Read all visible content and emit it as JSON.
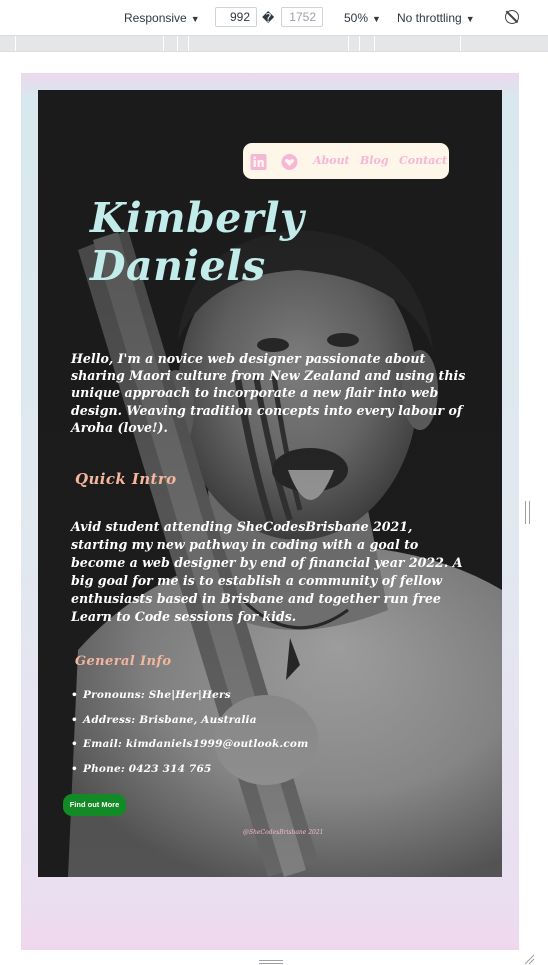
{
  "devtools": {
    "device_mode": "Responsive",
    "width": "992",
    "height_placeholder": "1752",
    "dimension_separator": "�",
    "zoom": "50%",
    "throttling": "No throttling",
    "rotate_icon": "rotate-icon"
  },
  "site": {
    "nav": {
      "linkedin_icon": "linkedin-icon",
      "heart_icon": "heart-icon",
      "links": [
        "About",
        "Blog",
        "Contact"
      ]
    },
    "hero": {
      "name_line1": "Kimberly",
      "name_line2": "Daniels",
      "background": "Black and white photo of a man performing a haka with tongue out, holding a wooden taiaha"
    },
    "bio": "Hello, I'm a novice web designer passionate about sharing Maori culture from New Zealand and using this unique approach to incorporate a new flair into web design. Weaving tradition concepts into every labour of Aroha (love!).",
    "quick_intro": {
      "title": "Quick Intro",
      "text": "Avid student attending SheCodesBrisbane 2021, starting my new pathway in coding with a goal to become a web designer by end of financial year 2022. A big goal for me is to establish a community of fellow enthusiasts based in Brisbane and together run free Learn to Code sessions for kids."
    },
    "general_info": {
      "title": "General Info",
      "items": [
        "Pronouns: She|Her|Hers",
        "Address: Brisbane, Australia",
        "Email: kimdaniels1999@outlook.com",
        "Phone: 0423 314 765"
      ]
    },
    "cta_label": "Find out More",
    "footer": "@SheCodesBrisbane 2021"
  },
  "colors": {
    "name": "#c2ecea",
    "section_title": "#f4b69d",
    "nav_bg": "#fdf6e9",
    "nav_accent": "#f6b7d6",
    "cta": "#128a25",
    "frame_pink": "#ecd8ee",
    "frame_blue": "#d7e9ee"
  }
}
